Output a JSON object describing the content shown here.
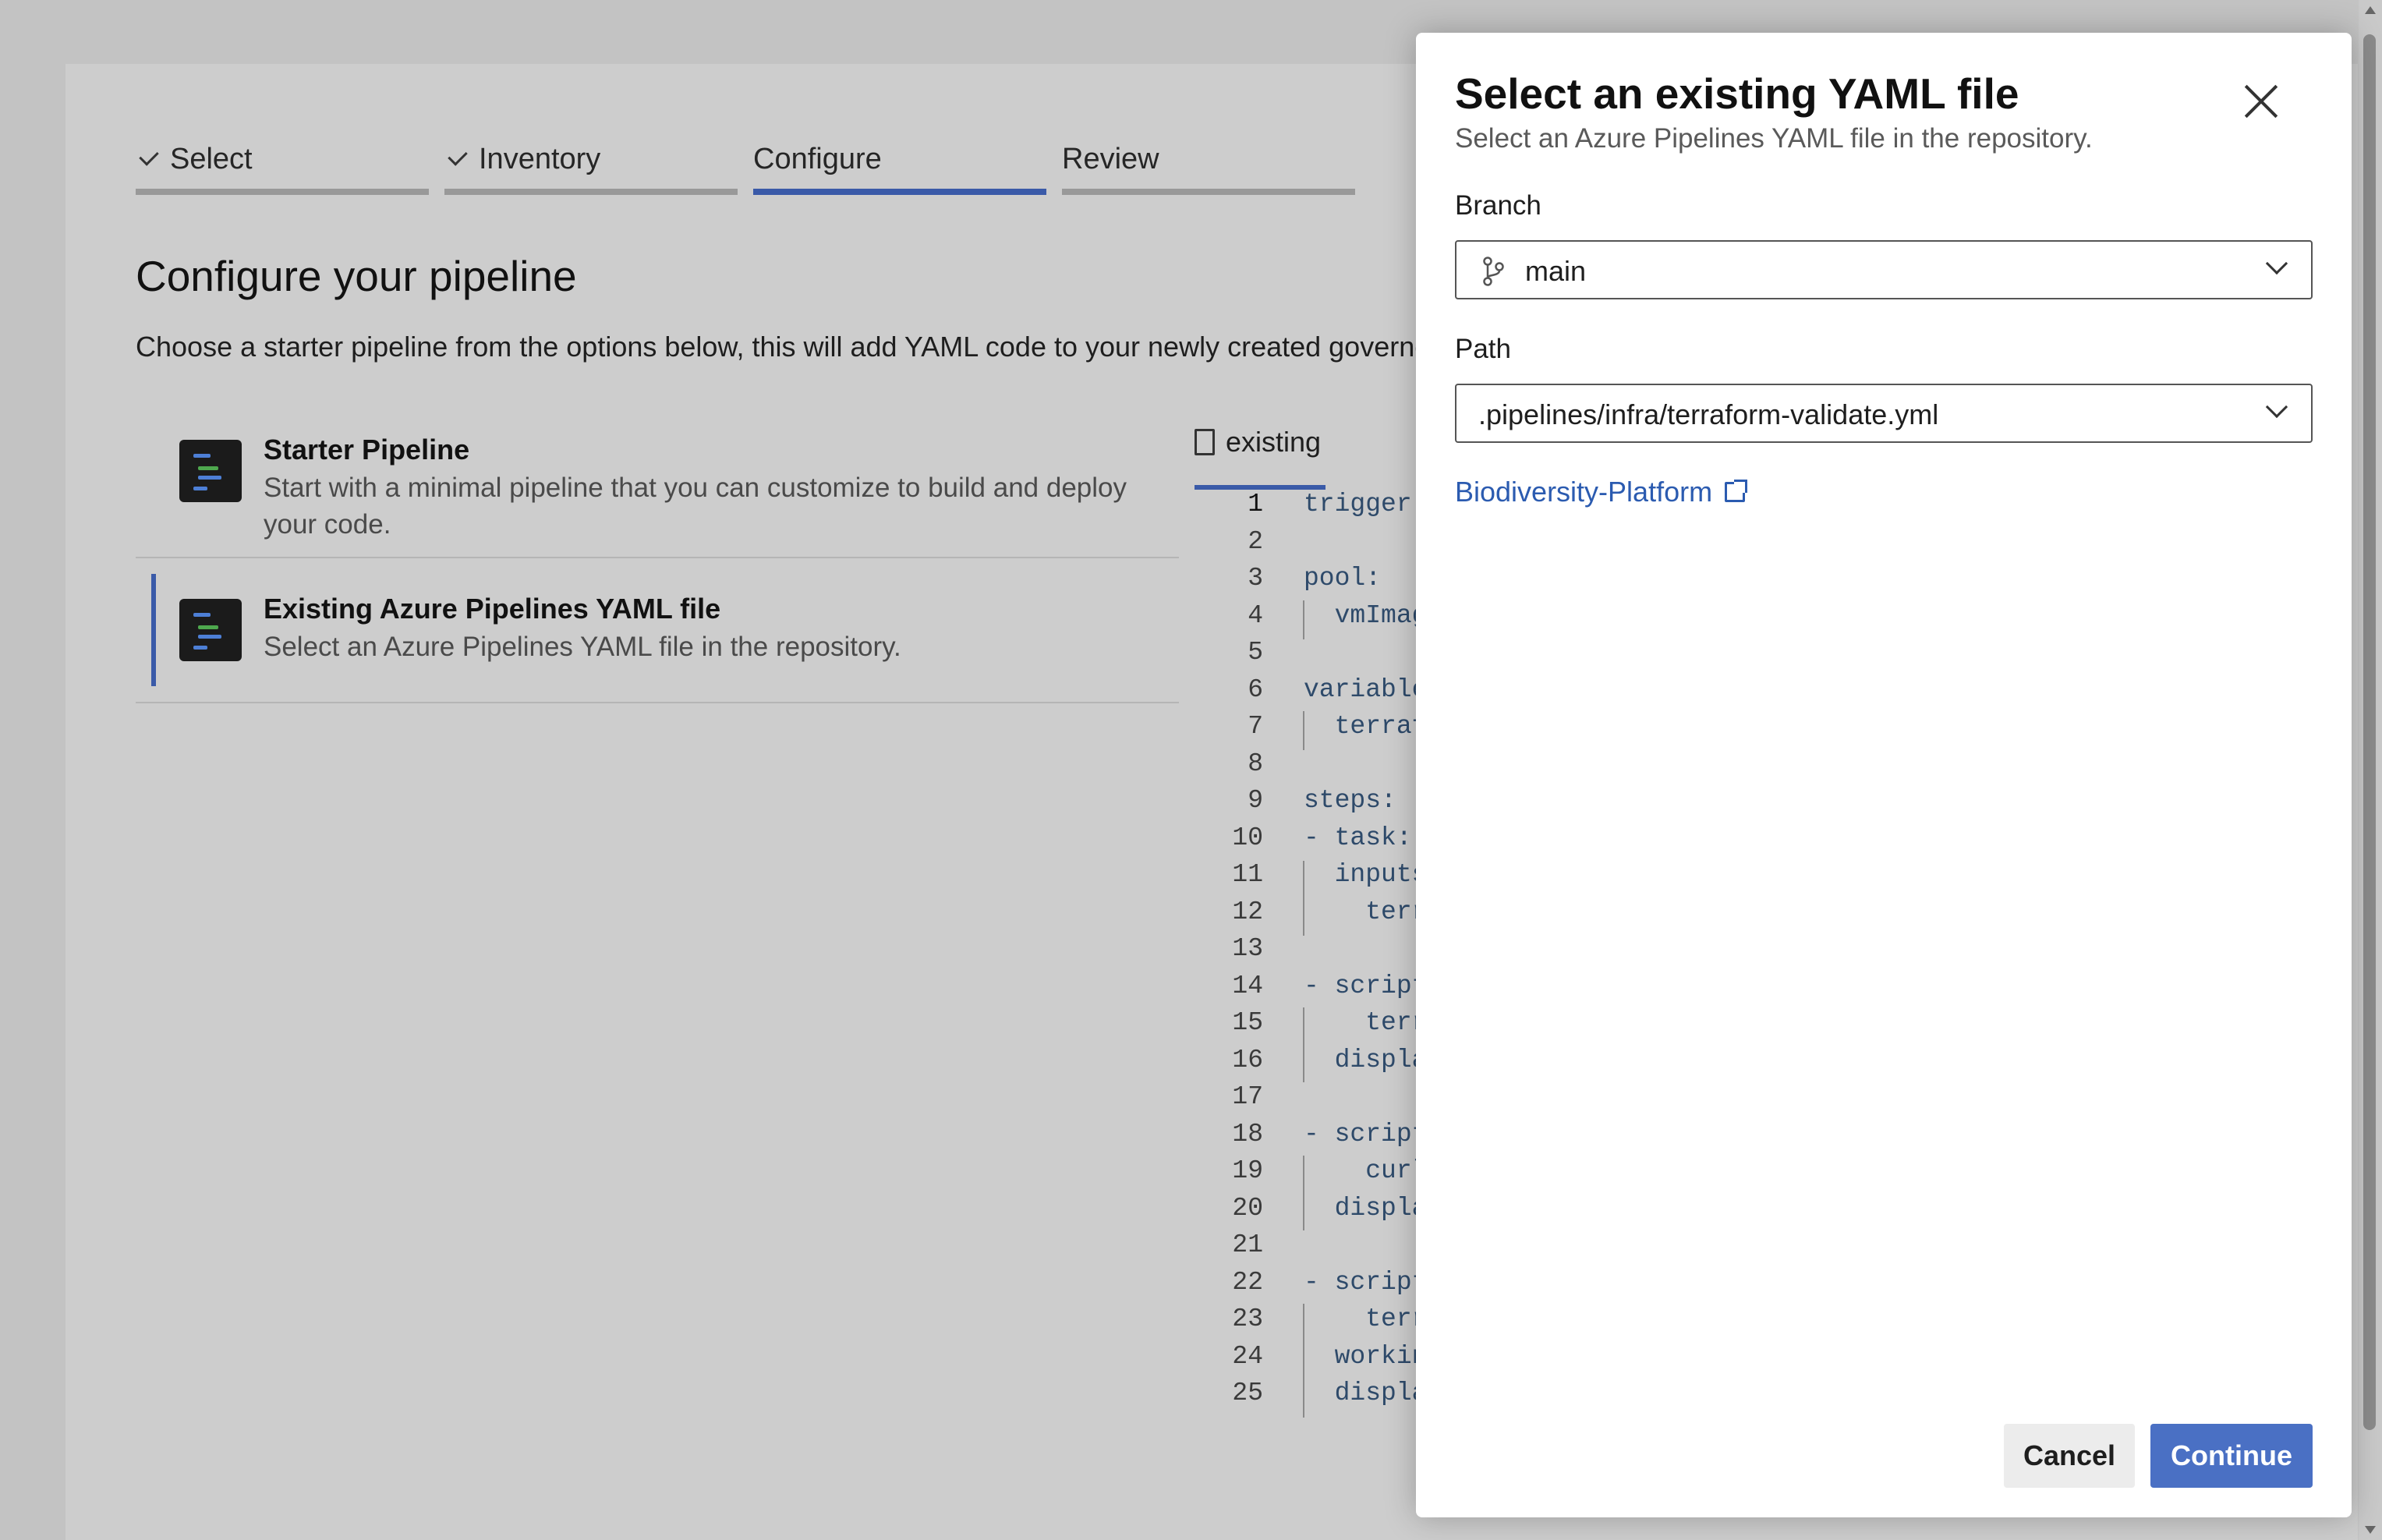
{
  "wizard": {
    "steps": [
      {
        "label": "Select",
        "done": true
      },
      {
        "label": "Inventory",
        "done": true
      },
      {
        "label": "Configure",
        "active": true
      },
      {
        "label": "Review"
      }
    ],
    "heading": "Configure your pipeline",
    "description": "Choose a starter pipeline from the options below, this will add YAML code to your newly created governed",
    "options": [
      {
        "title": "Starter Pipeline",
        "desc_line1": "Start with a minimal pipeline that you can customize to build and deploy",
        "desc_line2": "your code."
      },
      {
        "title": "Existing Azure Pipelines YAML file",
        "desc": "Select an Azure Pipelines YAML file in the repository.",
        "selected": true
      }
    ]
  },
  "editor": {
    "file_tab": "existing",
    "lines": [
      {
        "n": "1",
        "t": "trigger:"
      },
      {
        "n": "2",
        "t": ""
      },
      {
        "n": "3",
        "t": "pool:"
      },
      {
        "n": "4",
        "t": "  vmImag"
      },
      {
        "n": "5",
        "t": ""
      },
      {
        "n": "6",
        "t": "variable"
      },
      {
        "n": "7",
        "t": "  terraf"
      },
      {
        "n": "8",
        "t": ""
      },
      {
        "n": "9",
        "t": "steps:"
      },
      {
        "n": "10",
        "t": "- task:"
      },
      {
        "n": "11",
        "t": "  inputs"
      },
      {
        "n": "12",
        "t": "    terr"
      },
      {
        "n": "13",
        "t": ""
      },
      {
        "n": "14",
        "t": "- script"
      },
      {
        "n": "15",
        "t": "    terr"
      },
      {
        "n": "16",
        "t": "  displa"
      },
      {
        "n": "17",
        "t": ""
      },
      {
        "n": "18",
        "t": "- script"
      },
      {
        "n": "19",
        "t": "    curl"
      },
      {
        "n": "20",
        "t": "  displa"
      },
      {
        "n": "21",
        "t": ""
      },
      {
        "n": "22",
        "t": "- script"
      },
      {
        "n": "23",
        "t": "    terr"
      },
      {
        "n": "24",
        "t": "  workin"
      },
      {
        "n": "25",
        "t": "  displa"
      }
    ]
  },
  "dialog": {
    "title": "Select an existing YAML file",
    "subtitle": "Select an Azure Pipelines YAML file in the repository.",
    "branch_label": "Branch",
    "branch_value": "main",
    "path_label": "Path",
    "path_value": ".pipelines/infra/terraform-validate.yml",
    "repo_link": "Biodiversity-Platform",
    "cancel_label": "Cancel",
    "continue_label": "Continue"
  },
  "colors": {
    "accent": "#3a5aa8",
    "primary_button": "#4a70c4",
    "link": "#2b5bb0",
    "backdrop": "#cdcdcd"
  }
}
